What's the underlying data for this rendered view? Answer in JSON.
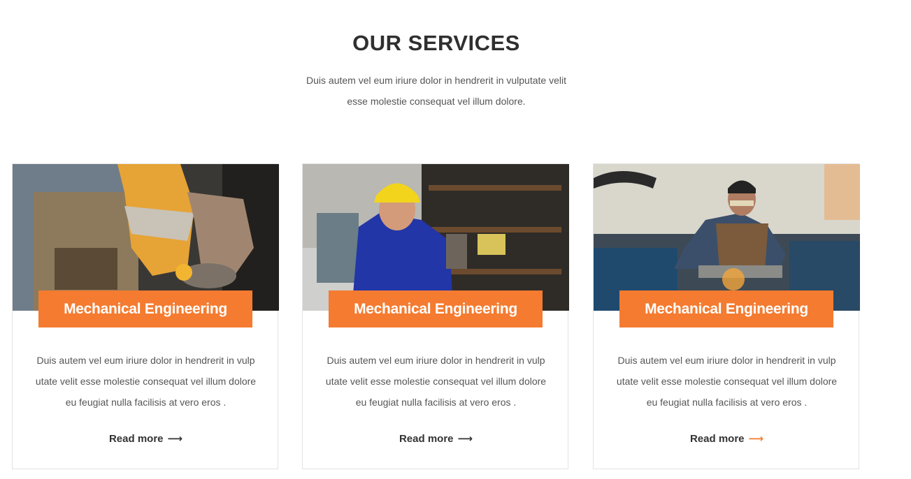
{
  "section": {
    "title": "OUR SERVICES",
    "subtitle_line1": "Duis autem vel eum iriure dolor in hendrerit in vulputate velit",
    "subtitle_line2": "esse molestie consequat vel illum dolore."
  },
  "colors": {
    "accent": "#f47b30",
    "heading": "#2f2f2f",
    "text": "#555555",
    "border": "#e3e3e3"
  },
  "cards": [
    {
      "title": "Mechanical Engineering",
      "text_line1": "Duis autem vel eum iriure dolor in hendrerit in vulp",
      "text_line2": "utate velit esse molestie consequat vel illum dolore",
      "text_line3": "eu feugiat nulla facilisis at vero eros .",
      "link_label": "Read more",
      "link_icon": "arrow-right-icon"
    },
    {
      "title": "Mechanical Engineering",
      "text_line1": "Duis autem vel eum iriure dolor in hendrerit in vulp",
      "text_line2": "utate velit esse molestie consequat vel illum dolore",
      "text_line3": "eu feugiat nulla facilisis at vero eros .",
      "link_label": "Read more",
      "link_icon": "arrow-right-icon"
    },
    {
      "title": "Mechanical Engineering",
      "text_line1": "Duis autem vel eum iriure dolor in hendrerit in vulp",
      "text_line2": "utate velit esse molestie consequat vel illum dolore",
      "text_line3": "eu feugiat nulla facilisis at vero eros .",
      "link_label": "Read more",
      "link_icon": "arrow-right-icon"
    }
  ]
}
